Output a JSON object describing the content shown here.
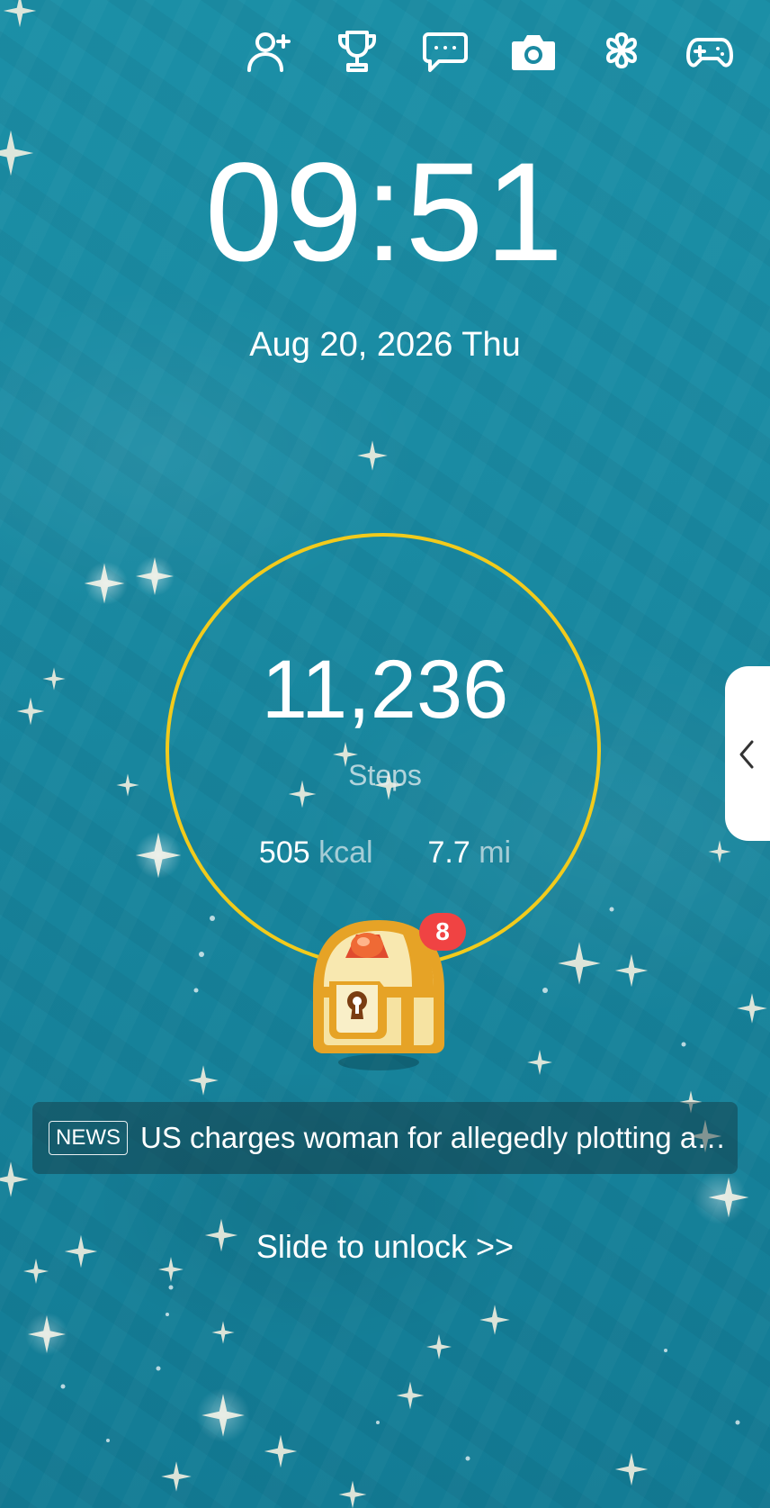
{
  "top_icons": [
    {
      "name": "add-friend-icon"
    },
    {
      "name": "trophy-icon"
    },
    {
      "name": "chat-icon"
    },
    {
      "name": "camera-icon"
    },
    {
      "name": "clover-icon"
    },
    {
      "name": "gamepad-icon"
    }
  ],
  "clock": {
    "time": "09:51",
    "date": "Aug 20, 2026 Thu"
  },
  "steps": {
    "value": "11,236",
    "label": "Steps",
    "calories_value": "505",
    "calories_unit": "kcal",
    "distance_value": "7.7",
    "distance_unit": "mi",
    "ring_color": "#f2cb1c"
  },
  "treasure_chest": {
    "badge_count": "8",
    "badge_color": "#f04343"
  },
  "news": {
    "tag": "NEWS",
    "headline": "US charges woman for allegedly plotting attac..."
  },
  "unlock": {
    "label": "Slide to unlock >>"
  }
}
